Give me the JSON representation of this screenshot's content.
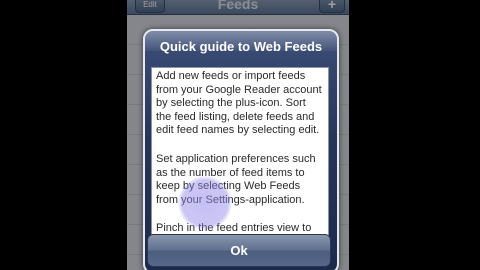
{
  "navbar": {
    "edit_label": "Edit",
    "title": "Feeds",
    "add_label": "+"
  },
  "alert": {
    "title": "Quick guide to Web Feeds",
    "paragraphs": [
      "Add new feeds or import feeds from your Google Reader account by selecting the plus-icon. Sort the feed listing, delete feeds and edit feed names by selecting edit.",
      "Set application preferences such as the number of feed items to keep by selecting Web Feeds from your Settings-application.",
      "Pinch in the feed entries view to"
    ],
    "ok_label": "Ok"
  }
}
